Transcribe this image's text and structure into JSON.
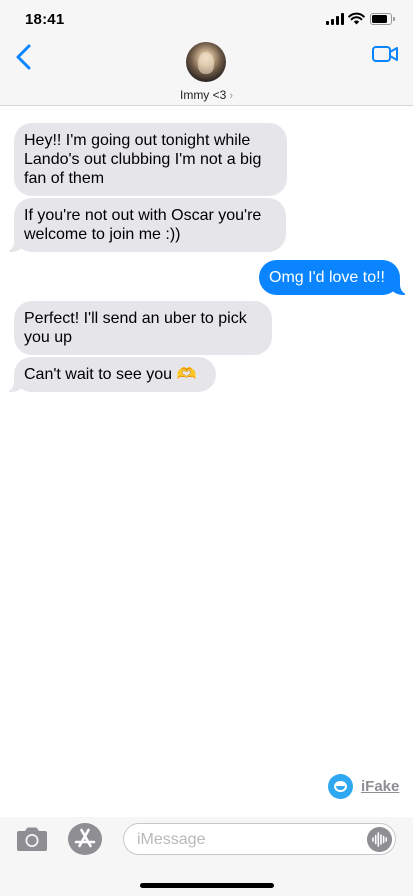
{
  "status_bar": {
    "time": "18:41",
    "icons": [
      "cellular-signal-icon",
      "wifi-icon",
      "battery-icon"
    ]
  },
  "header": {
    "back_icon": "chevron-left-icon",
    "contact_name": "Immy <3",
    "name_chevron": "›",
    "video_icon": "video-camera-icon",
    "accent_color": "#0a84ff"
  },
  "messages": [
    {
      "direction": "incoming",
      "text": "Hey!! I'm going out tonight while Lando's out clubbing I'm not a big fan of them"
    },
    {
      "direction": "incoming",
      "text": "If you're not out with Oscar you're welcome to join me :))"
    },
    {
      "direction": "outgoing",
      "text": "Omg I'd love to!!"
    },
    {
      "direction": "incoming",
      "text": "Perfect! I'll send an uber to pick you up"
    },
    {
      "direction": "incoming",
      "text": "Can't wait to see you 🫶"
    }
  ],
  "watermark": {
    "label": "iFake",
    "icon": "ifake-logo-icon"
  },
  "input_bar": {
    "camera_icon": "camera-icon",
    "apps_icon": "app-store-icon",
    "placeholder": "iMessage",
    "audio_icon": "audio-waveform-icon"
  },
  "colors": {
    "incoming_bubble": "#e5e5ea",
    "outgoing_bubble": "#0a84ff",
    "bar_background": "#f6f6f6"
  }
}
